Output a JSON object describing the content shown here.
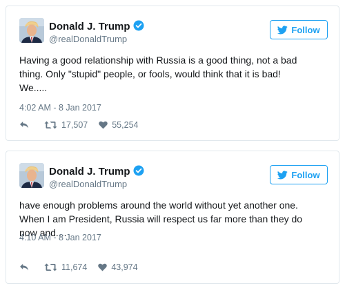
{
  "colors": {
    "twitter_blue": "#1da1f2",
    "text_primary": "#14171a",
    "text_secondary": "#657786",
    "border": "#e1e8ed"
  },
  "tweets": [
    {
      "author": {
        "name": "Donald J. Trump",
        "handle": "@realDonaldTrump",
        "verified": true,
        "avatar_icon": "profile-photo"
      },
      "follow_label": "Follow",
      "text_lines": [
        "Having a good relationship with Russia is a good thing, not a bad",
        "thing. Only \"stupid\" people, or fools, would think that it is bad!",
        "We....."
      ],
      "timestamp": "4:02 AM - 8 Jan 2017",
      "retweets": "17,507",
      "likes": "55,254"
    },
    {
      "author": {
        "name": "Donald J. Trump",
        "handle": "@realDonaldTrump",
        "verified": true,
        "avatar_icon": "profile-photo"
      },
      "follow_label": "Follow",
      "text_lines": [
        "have enough problems around the world without yet another one.",
        "When I am President, Russia will respect us far more than they do",
        "now and...."
      ],
      "timestamp": "4:10 AM - 8 Jan 2017",
      "retweets": "11,674",
      "likes": "43,974"
    }
  ]
}
